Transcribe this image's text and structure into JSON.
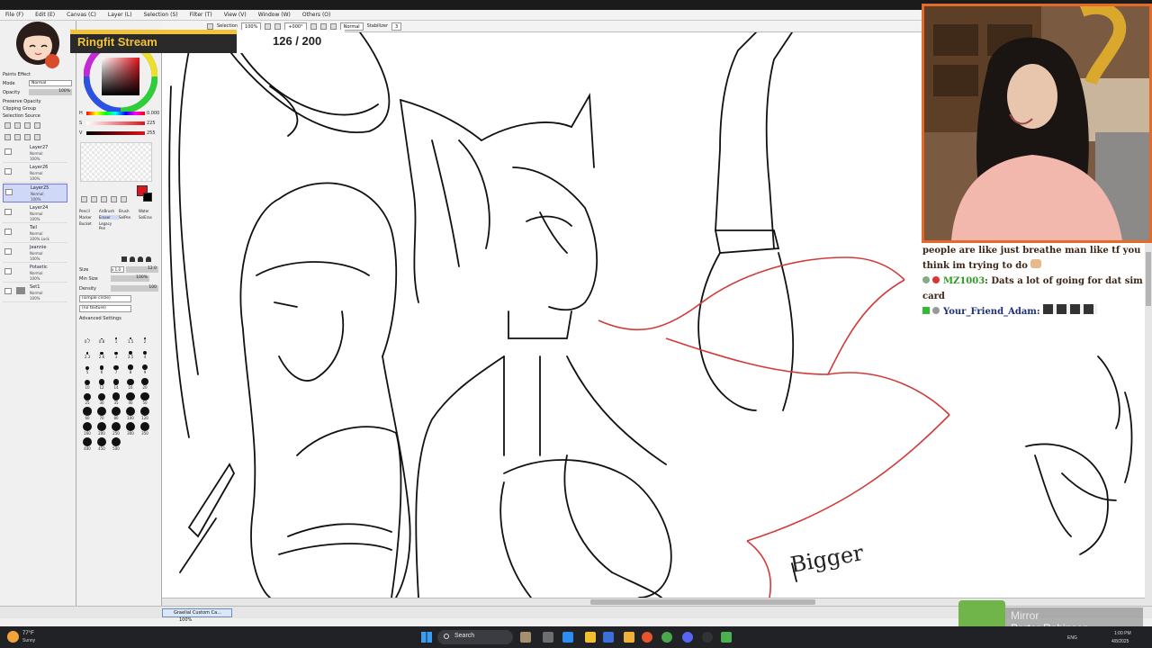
{
  "menu": {
    "items": [
      "File (F)",
      "Edit (E)",
      "Canvas (C)",
      "Layer (L)",
      "Selection (S)",
      "Filter (T)",
      "View (V)",
      "Window (W)",
      "Others (O)"
    ]
  },
  "toolbar": {
    "selection_label": "Selection",
    "zoom_value": "100%",
    "rotate_value": "+000°",
    "blend_mode": "Normal",
    "stabilizer_label": "Stabilizer",
    "stabilizer_value": "3"
  },
  "overlay": {
    "stream_title": "Ringfit Stream",
    "counter": "126 / 200"
  },
  "left_panel": {
    "paint_effect_label": "Paints Effect",
    "mode_label": "Mode",
    "mode_value": "Normal",
    "opacity_label": "Opacity",
    "opacity_value": "100%",
    "checkboxes": [
      "Preserve Opacity",
      "Clipping Group",
      "Selection Source"
    ],
    "layers": [
      {
        "name": "Layer27",
        "mode": "Normal",
        "opacity": "100%"
      },
      {
        "name": "Layer26",
        "mode": "Normal",
        "opacity": "100%"
      },
      {
        "name": "Layer25",
        "mode": "Normal",
        "opacity": "100%"
      },
      {
        "name": "Layer24",
        "mode": "Normal",
        "opacity": "100%"
      },
      {
        "name": "Tail",
        "mode": "Normal",
        "opacity": "100% Lock"
      },
      {
        "name": "Jeannie",
        "mode": "Normal",
        "opacity": "100%"
      },
      {
        "name": "Potastic",
        "mode": "Normal",
        "opacity": "100%"
      },
      {
        "name": "Set1",
        "mode": "Normal",
        "opacity": "100%"
      }
    ]
  },
  "color_panel": {
    "h_label": "H",
    "h_value": "0.000",
    "s_label": "S",
    "s_value": "225",
    "v_label": "V",
    "v_value": "255"
  },
  "tools": {
    "tool_names": [
      "Pencil",
      "AirBrush",
      "Brush",
      "Water",
      "Marker",
      "Eraser",
      "SelPen",
      "SelEras",
      "Bucket",
      "Legacy Pen"
    ],
    "size_label": "Size",
    "size_mult": "x 1.0",
    "size_value": "12.0",
    "min_size_label": "Min Size",
    "min_size_value": "100%",
    "density_label": "Density",
    "density_value": "100",
    "shape_value": "(simple circle)",
    "texture_value": "(no texture)",
    "advanced_label": "Advanced Settings",
    "brush_sizes": [
      "0.7",
      "0.8",
      "1",
      "1.5",
      "2",
      "2.3",
      "2.6",
      "3",
      "3.5",
      "4",
      "5",
      "6",
      "7",
      "8",
      "9",
      "10",
      "12",
      "14",
      "16",
      "20",
      "25",
      "30",
      "35",
      "40",
      "50",
      "60",
      "70",
      "80",
      "100",
      "120",
      "160",
      "200",
      "250",
      "300",
      "350",
      "400",
      "450",
      "500"
    ]
  },
  "status": {
    "doc_tab": "Graelial Custom Ca...",
    "doc_zoom": "100%"
  },
  "chat": {
    "lines": [
      {
        "user": "",
        "text": "people are like just breathe man like tf you"
      },
      {
        "user": "",
        "text": "think im trying to do"
      },
      {
        "user": "MZ1003",
        "text": "Dats a lot of going for dat sim"
      },
      {
        "user": "",
        "text": "card"
      },
      {
        "user": "Your_Friend_Adam",
        "text": ""
      }
    ]
  },
  "music": {
    "title": "Mirror",
    "artist": "Porter Robinson"
  },
  "taskbar": {
    "weather_temp": "77°F",
    "weather_desc": "Sunny",
    "search_label": "Search",
    "language": "ENG",
    "time": "1:00 PM",
    "date": "4/8/2025"
  },
  "artwork": {
    "annotation": "Bigger"
  },
  "colors": {
    "overlay_yellow": "#f2c23a",
    "webcam_border": "#e46a2a",
    "red_sketch": "#d23a3a"
  }
}
